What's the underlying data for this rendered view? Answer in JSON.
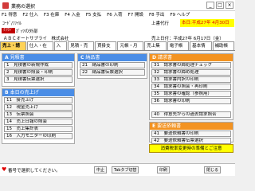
{
  "window": {
    "title": "業務の選択",
    "min": "_",
    "max": "□",
    "close": "×"
  },
  "menu": [
    "F1 得意",
    "F2 仕入",
    "F3 在庫",
    "F4 入金",
    "F5 支払",
    "F6 入荷",
    "F7 開設",
    "F8 手出",
    "F9 ヘルプ"
  ],
  "info": {
    "left": "ｺｰﾄﾞ/ﾌｧｲﾙ",
    "user": "上書代行",
    "date": "本日:平成27年 4月30日(木)"
  },
  "company_bar": {
    "tag": "ｸﾗｳﾄﾞ",
    "name": "ｶﾞｯﾂの外部"
  },
  "line3": {
    "company": "ＡＢＣオートサプライ　株式会社",
    "report_date": "売上日付：平成27年 6月17日（金）"
  },
  "tabs": [
    "売上・請求",
    "仕入・在庫",
    "入金",
    "見積・売上",
    "買掛支払",
    "元帳・月報",
    "売上集計",
    "電子帳簿",
    "基本情報",
    "補助帳票"
  ],
  "panels": {
    "A": {
      "title": "見積書",
      "items": [
        "1　見積書の新規作成",
        "2　見積書の照会・印刷",
        "3　見積書伝票選択"
      ]
    },
    "B": {
      "title": "本日の売上げ",
      "items": [
        "11　掛売上げ",
        "12　現金売上げ",
        "13　伝票照会",
        "14　売上日報の照会",
        "15　売上集計表",
        "16　入力モニターの印刷"
      ]
    },
    "C": {
      "title": "納品書",
      "items": [
        "21　納品書の印刷",
        "22　納品書伝票選択"
      ]
    },
    "D": {
      "title": "請求書",
      "items": [
        "31　請求書の締処理チェック",
        "32　請求書の締め処理",
        "33　請求書内訳の印刷",
        "34　請求書の照会・再印刷",
        "35　請求書の確認（参照用）",
        "36　請求書の印刷",
        "",
        "40　得意先からの過去請求照合"
      ]
    },
    "E": {
      "title": "要送依頼書",
      "items": [
        "41　要送依頼書の印刷",
        "42　要送依頼書伝票選択"
      ]
    }
  },
  "action_button": "消費税率変更時の準備とご注意",
  "status": {
    "message": "番号で選択してください。",
    "keys": [
      "中止",
      "Tabタブ切替",
      "印刷",
      "閉じる"
    ]
  },
  "colors": {
    "blue_header": "#4a8de6",
    "orange_header": "#f39321",
    "active_tab": "#ffd257",
    "date_bg": "#ffff00"
  }
}
